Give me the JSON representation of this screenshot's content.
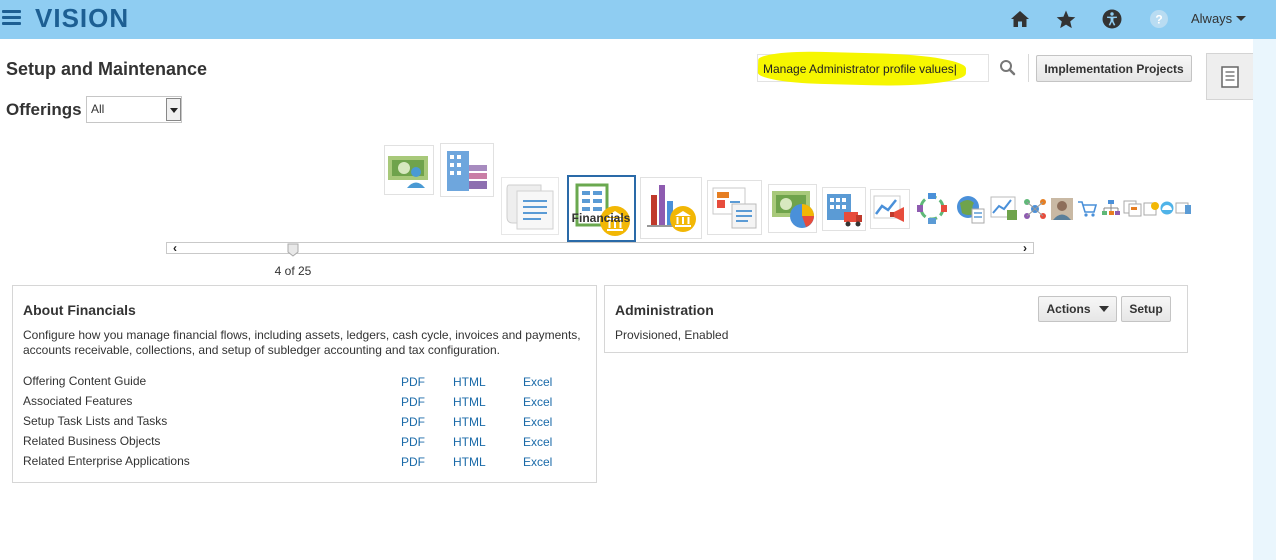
{
  "header": {
    "logo": "VISION",
    "user_menu_label": "Always",
    "icons": [
      "home-icon",
      "favorites-star-icon",
      "accessibility-icon",
      "help-icon"
    ]
  },
  "page": {
    "title": "Setup and Maintenance",
    "offerings_label": "Offerings",
    "offerings_selected": "All"
  },
  "search": {
    "value": "Manage Administrator profile values|"
  },
  "toolbar": {
    "implementation_projects_label": "Implementation Projects"
  },
  "filmstrip": {
    "selected_caption": "Financials",
    "position_text": "4 of 25",
    "selected_index": 3,
    "total": 25
  },
  "about": {
    "title": "About Financials",
    "description": "Configure how you manage financial flows, including assets, ledgers, cash cycle, invoices and payments, accounts receivable, collections, and setup of subledger accounting and tax configuration.",
    "rows": [
      {
        "label": "Offering Content Guide",
        "pdf": "PDF",
        "html": "HTML",
        "excel": "Excel"
      },
      {
        "label": "Associated Features",
        "pdf": "PDF",
        "html": "HTML",
        "excel": "Excel"
      },
      {
        "label": "Setup Task Lists and Tasks",
        "pdf": "PDF",
        "html": "HTML",
        "excel": "Excel"
      },
      {
        "label": "Related Business Objects",
        "pdf": "PDF",
        "html": "HTML",
        "excel": "Excel"
      },
      {
        "label": "Related Enterprise Applications",
        "pdf": "PDF",
        "html": "HTML",
        "excel": "Excel"
      }
    ]
  },
  "admin": {
    "title": "Administration",
    "status": "Provisioned, Enabled",
    "actions_label": "Actions",
    "setup_label": "Setup"
  },
  "colors": {
    "header_bg": "#8fcdf2",
    "brand": "#1d5f93",
    "link": "#1a6aa8",
    "search_highlight": "#f6f600",
    "selected_border": "#2a6aa8"
  }
}
